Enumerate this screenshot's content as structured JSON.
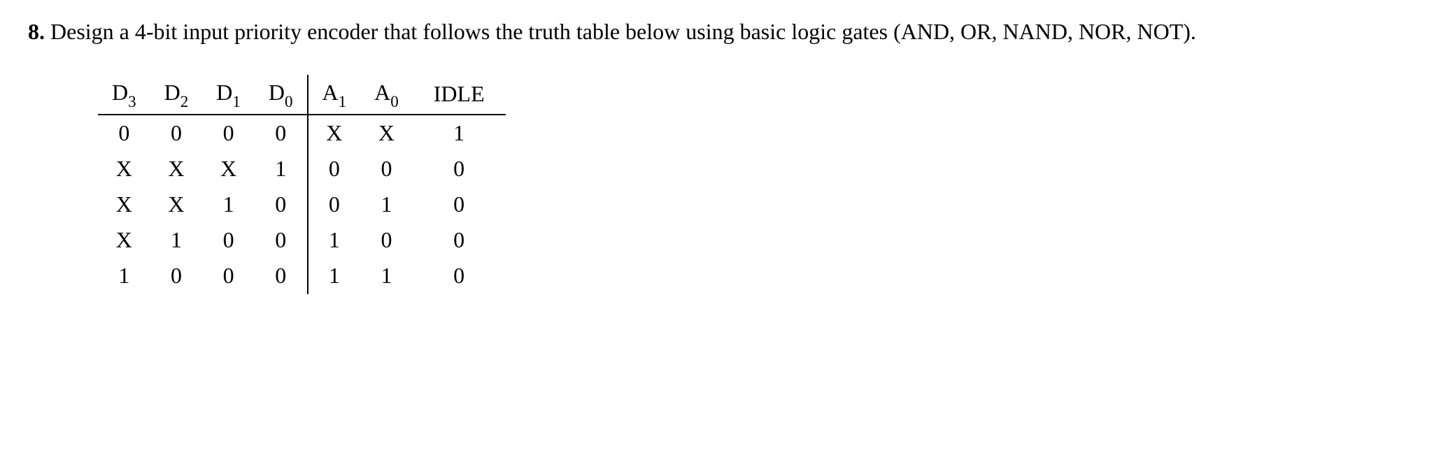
{
  "question": {
    "number": "8.",
    "text": "Design a 4-bit input priority encoder that follows the truth table below using basic logic gates (AND, OR, NAND, NOR, NOT)."
  },
  "table": {
    "headers": {
      "d3_base": "D",
      "d3_sub": "3",
      "d2_base": "D",
      "d2_sub": "2",
      "d1_base": "D",
      "d1_sub": "1",
      "d0_base": "D",
      "d0_sub": "0",
      "a1_base": "A",
      "a1_sub": "1",
      "a0_base": "A",
      "a0_sub": "0",
      "idle": "IDLE"
    },
    "rows": [
      {
        "d3": "0",
        "d2": "0",
        "d1": "0",
        "d0": "0",
        "a1": "X",
        "a0": "X",
        "idle": "1"
      },
      {
        "d3": "X",
        "d2": "X",
        "d1": "X",
        "d0": "1",
        "a1": "0",
        "a0": "0",
        "idle": "0"
      },
      {
        "d3": "X",
        "d2": "X",
        "d1": "1",
        "d0": "0",
        "a1": "0",
        "a0": "1",
        "idle": "0"
      },
      {
        "d3": "X",
        "d2": "1",
        "d1": "0",
        "d0": "0",
        "a1": "1",
        "a0": "0",
        "idle": "0"
      },
      {
        "d3": "1",
        "d2": "0",
        "d1": "0",
        "d0": "0",
        "a1": "1",
        "a0": "1",
        "idle": "0"
      }
    ]
  }
}
